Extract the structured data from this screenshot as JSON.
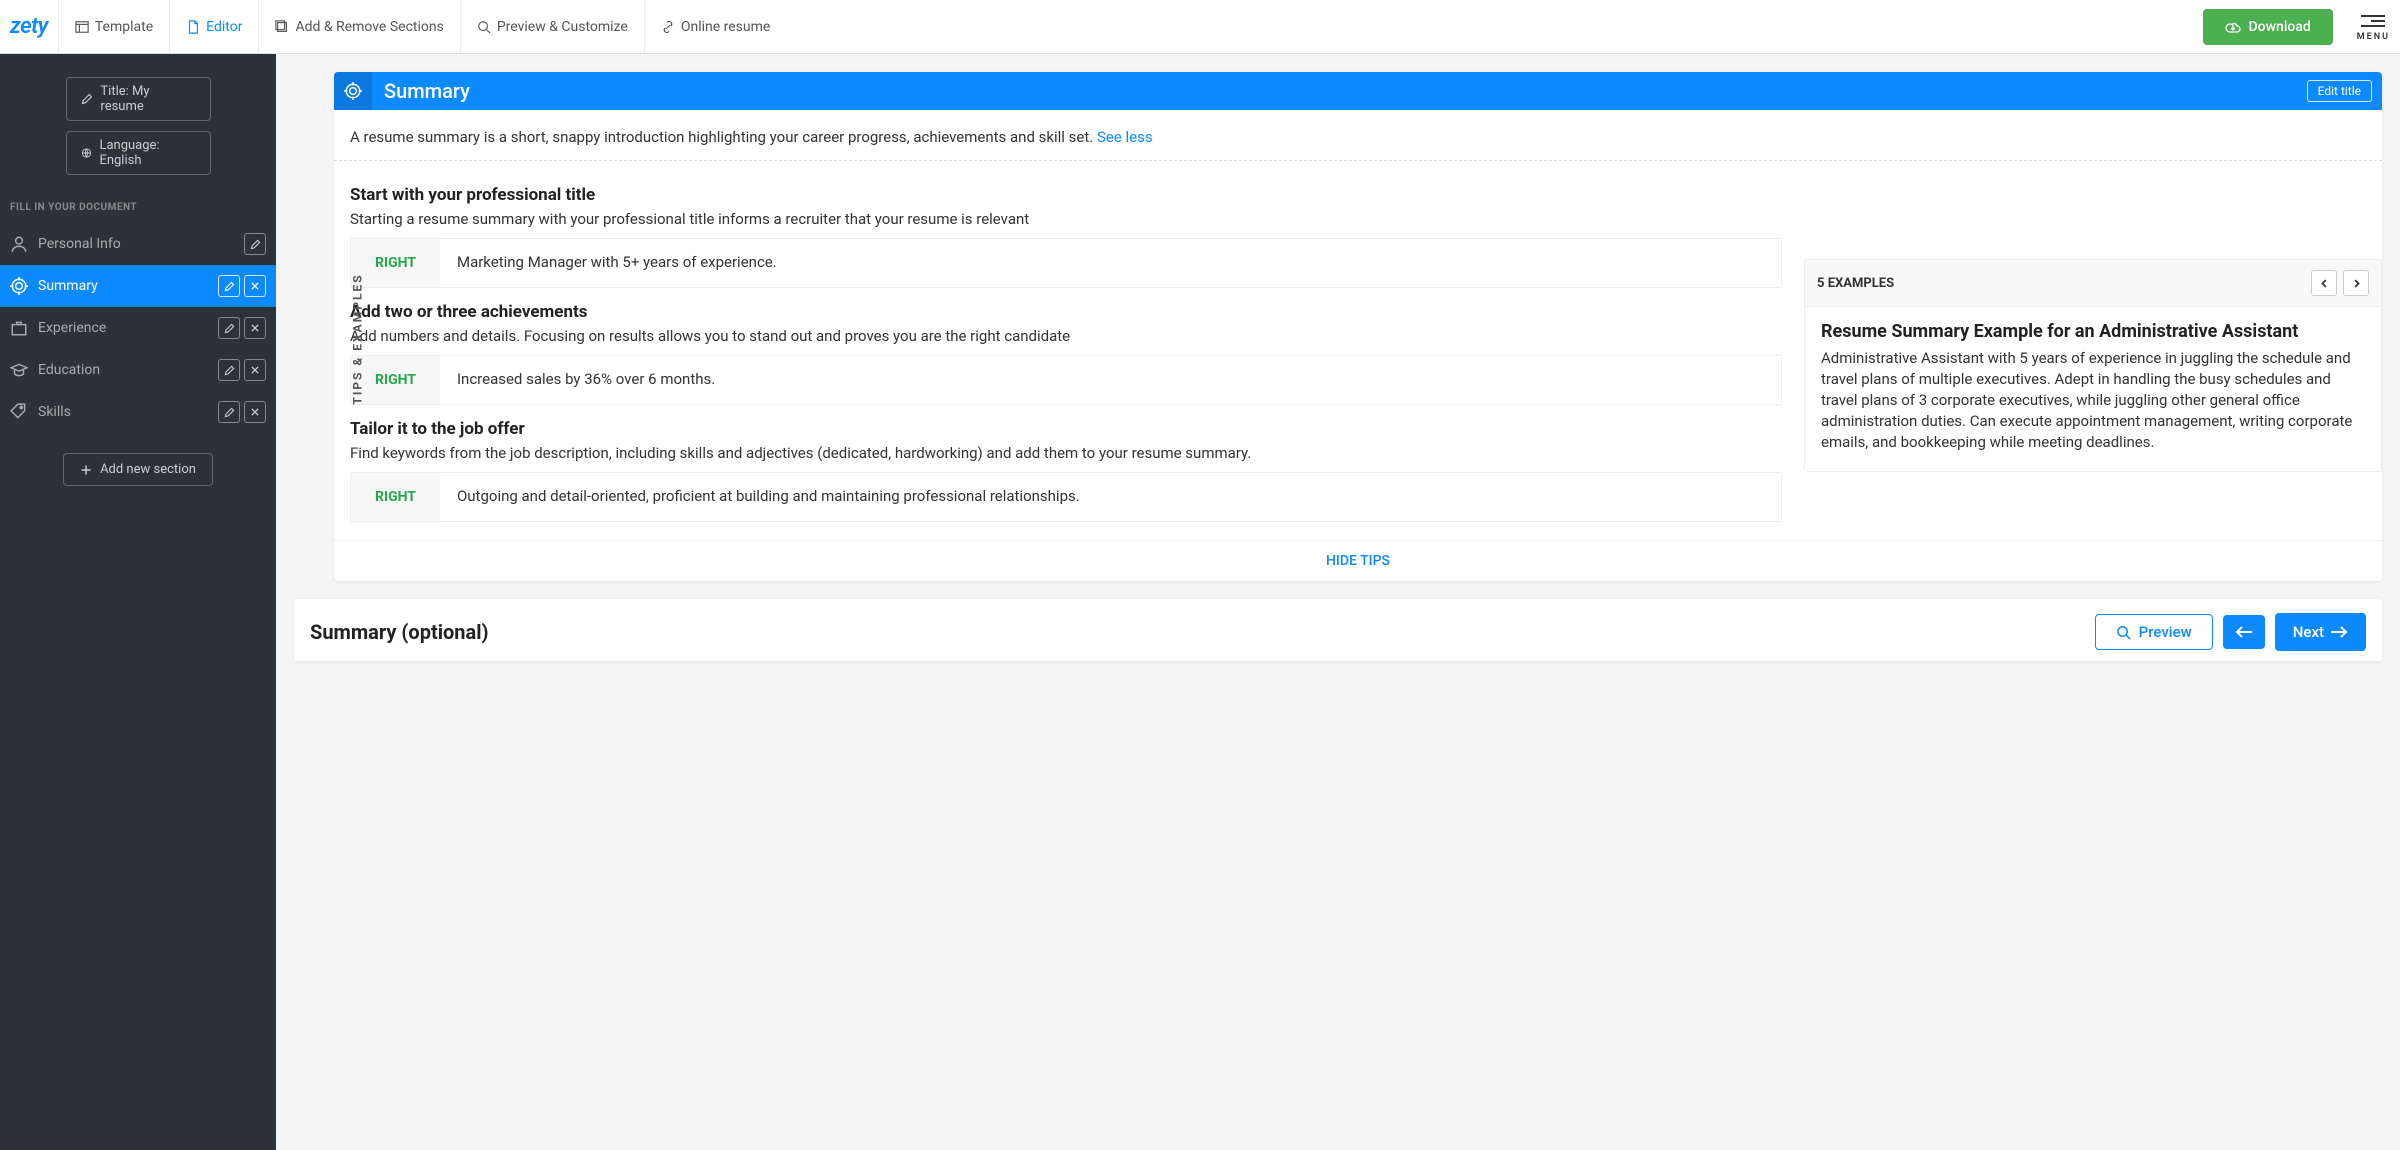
{
  "topnav": {
    "logo": "zety",
    "items": [
      {
        "label": "Template"
      },
      {
        "label": "Editor"
      },
      {
        "label": "Add & Remove Sections"
      },
      {
        "label": "Preview & Customize"
      },
      {
        "label": "Online resume"
      }
    ],
    "download": "Download",
    "menu": "MENU"
  },
  "sidebar": {
    "title_btn": "Title: My resume",
    "lang_btn": "Language: English",
    "header": "FILL IN YOUR DOCUMENT",
    "items": [
      {
        "label": "Personal Info",
        "edit": true,
        "del": false
      },
      {
        "label": "Summary",
        "edit": true,
        "del": true,
        "active": true
      },
      {
        "label": "Experience",
        "edit": true,
        "del": true
      },
      {
        "label": "Education",
        "edit": true,
        "del": true
      },
      {
        "label": "Skills",
        "edit": true,
        "del": true
      }
    ],
    "add_btn": "Add new section"
  },
  "section": {
    "title": "Summary",
    "edit_title": "Edit title",
    "intro": "A resume summary is a short, snappy introduction highlighting your career progress, achievements and skill set. ",
    "see_less": "See less",
    "vert_label": "TIPS & EXAMPLES",
    "tips": [
      {
        "heading": "Start with your professional title",
        "body": "Starting a resume summary with your professional title informs a recruiter that your resume is relevant",
        "right_label": "RIGHT",
        "right_text": "Marketing Manager with 5+ years of experience."
      },
      {
        "heading": "Add two or three achievements",
        "body": "Add numbers and details. Focusing on results allows you to stand out and proves you are the right candidate",
        "right_label": "RIGHT",
        "right_text": "Increased sales by 36% over 6 months."
      },
      {
        "heading": "Tailor it to the job offer",
        "body": "Find keywords from the job description, including skills and adjectives (dedicated, hardworking) and add them to your resume summary.",
        "right_label": "RIGHT",
        "right_text": "Outgoing and detail-oriented, proficient at building and maintaining professional relationships."
      }
    ],
    "examples": {
      "header": "5 EXAMPLES",
      "title": "Resume Summary Example for an Administrative Assistant",
      "body": "Administrative Assistant with 5 years of experience in juggling the schedule and travel plans of multiple executives. Adept in handling the busy schedules and travel plans of 3 corporate executives, while juggling other general office administration duties. Can execute appointment management, writing corporate emails, and bookkeeping while meeting deadlines."
    },
    "hide_tips": "HIDE TIPS"
  },
  "bottom": {
    "title": "Summary (optional)",
    "preview": "Preview",
    "next": "Next"
  }
}
